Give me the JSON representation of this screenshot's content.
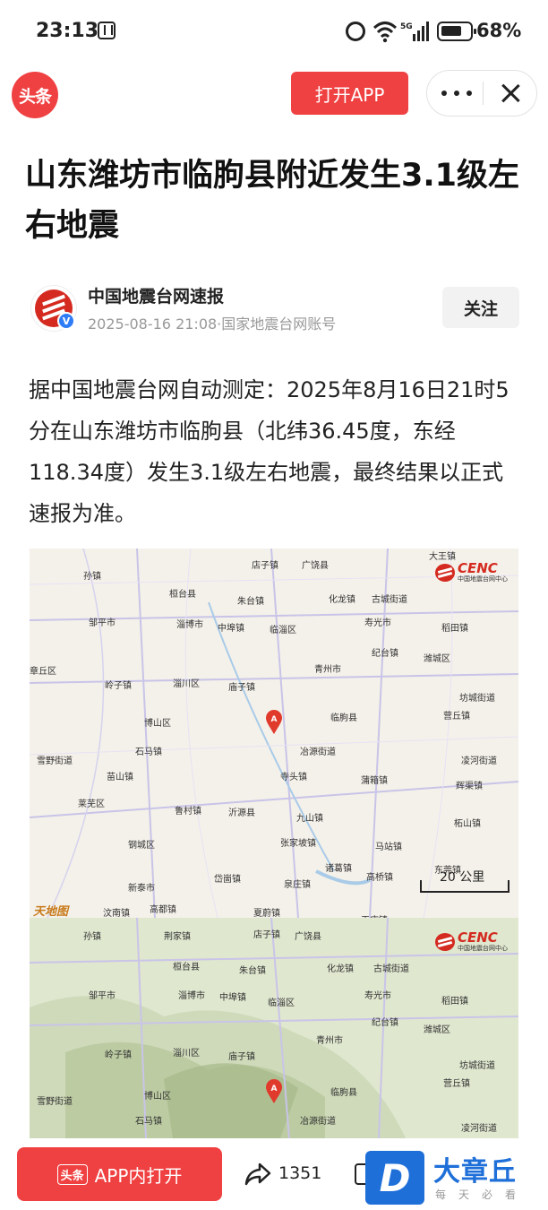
{
  "status_bar": {
    "time": "23:13",
    "battery": "68%"
  },
  "header": {
    "logo_text": "头条",
    "open_app_label": "打开APP"
  },
  "article": {
    "title": "山东潍坊市临朐县附近发生3.1级左右地震",
    "author": {
      "name": "中国地震台网速报",
      "meta": "2025-08-16 21:08·国家地震台网账号",
      "verified": "V"
    },
    "follow_label": "关注",
    "body": "据中国地震台网自动测定：2025年8月16日21时5分在山东潍坊市临朐县（北纬36.45度，东经118.34度）发生3.1级左右地震，最终结果以正式速报为准。"
  },
  "map_plain": {
    "logo_title": "CENC",
    "logo_subtitle": "中国地震台网中心",
    "scale_label": "20 公里",
    "credit": "天地图",
    "labels": [
      {
        "text": "大王镇"
      },
      {
        "text": "店子镇"
      },
      {
        "text": "广饶县"
      },
      {
        "text": "孙镇"
      },
      {
        "text": "桓台县"
      },
      {
        "text": "朱台镇"
      },
      {
        "text": "化龙镇"
      },
      {
        "text": "古城街道"
      },
      {
        "text": "邹平市"
      },
      {
        "text": "淄博市"
      },
      {
        "text": "中埠镇"
      },
      {
        "text": "临淄区"
      },
      {
        "text": "寿光市"
      },
      {
        "text": "稻田镇"
      },
      {
        "text": "章丘区"
      },
      {
        "text": "纪台镇"
      },
      {
        "text": "青州市"
      },
      {
        "text": "潍城区"
      },
      {
        "text": "岭子镇"
      },
      {
        "text": "淄川区"
      },
      {
        "text": "庙子镇"
      },
      {
        "text": "坊城街道"
      },
      {
        "text": "博山区"
      },
      {
        "text": "临朐县"
      },
      {
        "text": "营丘镇"
      },
      {
        "text": "雪野街道"
      },
      {
        "text": "石马镇"
      },
      {
        "text": "冶源街道"
      },
      {
        "text": "凌河街道"
      },
      {
        "text": "寺头镇"
      },
      {
        "text": "苗山镇"
      },
      {
        "text": "蒲箱镇"
      },
      {
        "text": "辉渠镇"
      },
      {
        "text": "莱芜区"
      },
      {
        "text": "鲁村镇"
      },
      {
        "text": "沂源县"
      },
      {
        "text": "九山镇"
      },
      {
        "text": "柘山镇"
      },
      {
        "text": "钢城区"
      },
      {
        "text": "张家坡镇"
      },
      {
        "text": "马站镇"
      },
      {
        "text": "诸葛镇"
      },
      {
        "text": "高桥镇"
      },
      {
        "text": "东莞镇"
      },
      {
        "text": "新泰市"
      },
      {
        "text": "岱崮镇"
      },
      {
        "text": "泉庄镇"
      },
      {
        "text": "汶南镇"
      },
      {
        "text": "高都镇"
      },
      {
        "text": "夏蔚镇"
      },
      {
        "text": "王庄镇"
      }
    ]
  },
  "map_terrain": {
    "logo_title": "CENC",
    "logo_subtitle": "中国地震台网中心",
    "labels": [
      {
        "text": "孙镇"
      },
      {
        "text": "荆家镇"
      },
      {
        "text": "店子镇"
      },
      {
        "text": "广饶县"
      },
      {
        "text": "桓台县"
      },
      {
        "text": "朱台镇"
      },
      {
        "text": "化龙镇"
      },
      {
        "text": "古城街道"
      },
      {
        "text": "邹平市"
      },
      {
        "text": "淄博市"
      },
      {
        "text": "中埠镇"
      },
      {
        "text": "临淄区"
      },
      {
        "text": "寿光市"
      },
      {
        "text": "稻田镇"
      },
      {
        "text": "纪台镇"
      },
      {
        "text": "青州市"
      },
      {
        "text": "潍城区"
      },
      {
        "text": "岭子镇"
      },
      {
        "text": "淄川区"
      },
      {
        "text": "庙子镇"
      },
      {
        "text": "坊城街道"
      },
      {
        "text": "博山区"
      },
      {
        "text": "临朐县"
      },
      {
        "text": "营丘镇"
      },
      {
        "text": "雪野街道"
      },
      {
        "text": "石马镇"
      },
      {
        "text": "冶源街道"
      },
      {
        "text": "凌河街道"
      }
    ]
  },
  "bottom_bar": {
    "app_badge": "头条",
    "open_in_app_label": "APP内打开",
    "share_count": "1351",
    "watermark_letter": "D",
    "watermark_brand": "大章丘",
    "watermark_slogan": "每天必看"
  }
}
